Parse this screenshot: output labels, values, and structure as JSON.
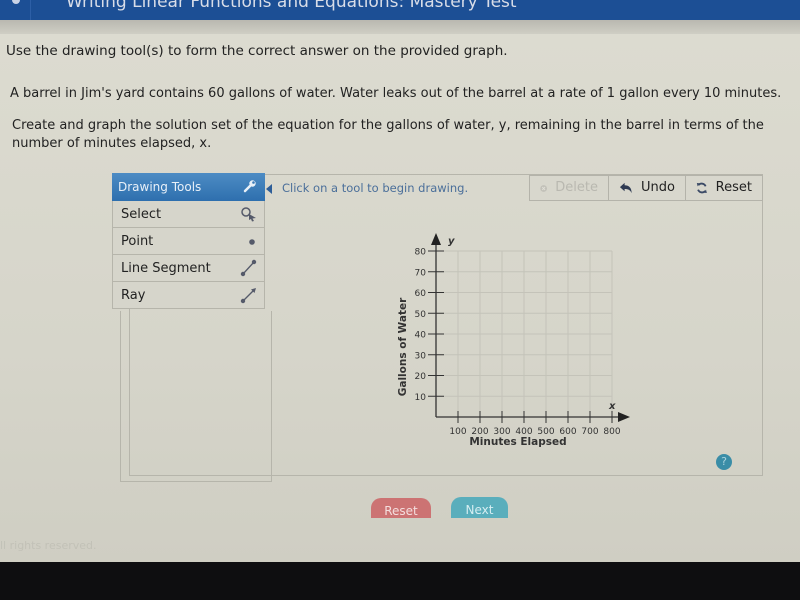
{
  "header": {
    "title": "Writing Linear Functions and Equations: Mastery Test"
  },
  "question": {
    "instruction": "Use the drawing tool(s) to form the correct answer on the provided graph.",
    "problem": "A barrel in Jim's yard contains 60 gallons of water. Water leaks out of the barrel at a rate of 1 gallon every 10 minutes.",
    "task": "Create and graph the solution set of the equation for the gallons of water, y, remaining in the barrel in terms of the number of minutes elapsed, x."
  },
  "drawing_tools": {
    "header": "Drawing Tools",
    "header_icon": "wrench-icon",
    "items": [
      {
        "label": "Select",
        "icon": "select-cursor-icon"
      },
      {
        "label": "Point",
        "icon": "point-icon"
      },
      {
        "label": "Line Segment",
        "icon": "line-segment-icon"
      },
      {
        "label": "Ray",
        "icon": "ray-icon"
      }
    ]
  },
  "toolbar": {
    "hint": "Click on a tool to begin drawing.",
    "delete_label": "Delete",
    "undo_label": "Undo",
    "reset_label": "Reset"
  },
  "graph": {
    "x_axis_label": "Minutes Elapsed",
    "y_axis_label": "Gallons of Water",
    "x_var": "x",
    "y_var": "y",
    "x_ticks": [
      "100",
      "200",
      "300",
      "400",
      "500",
      "600",
      "700",
      "800"
    ],
    "y_ticks": [
      "10",
      "20",
      "30",
      "40",
      "50",
      "60",
      "70",
      "80"
    ],
    "x_range": [
      0,
      800
    ],
    "y_range": [
      0,
      80
    ]
  },
  "help": {
    "label": "?"
  },
  "footer_buttons": {
    "reset_label": "Reset",
    "next_label": "Next"
  },
  "footer": {
    "text": "ll rights reserved."
  }
}
